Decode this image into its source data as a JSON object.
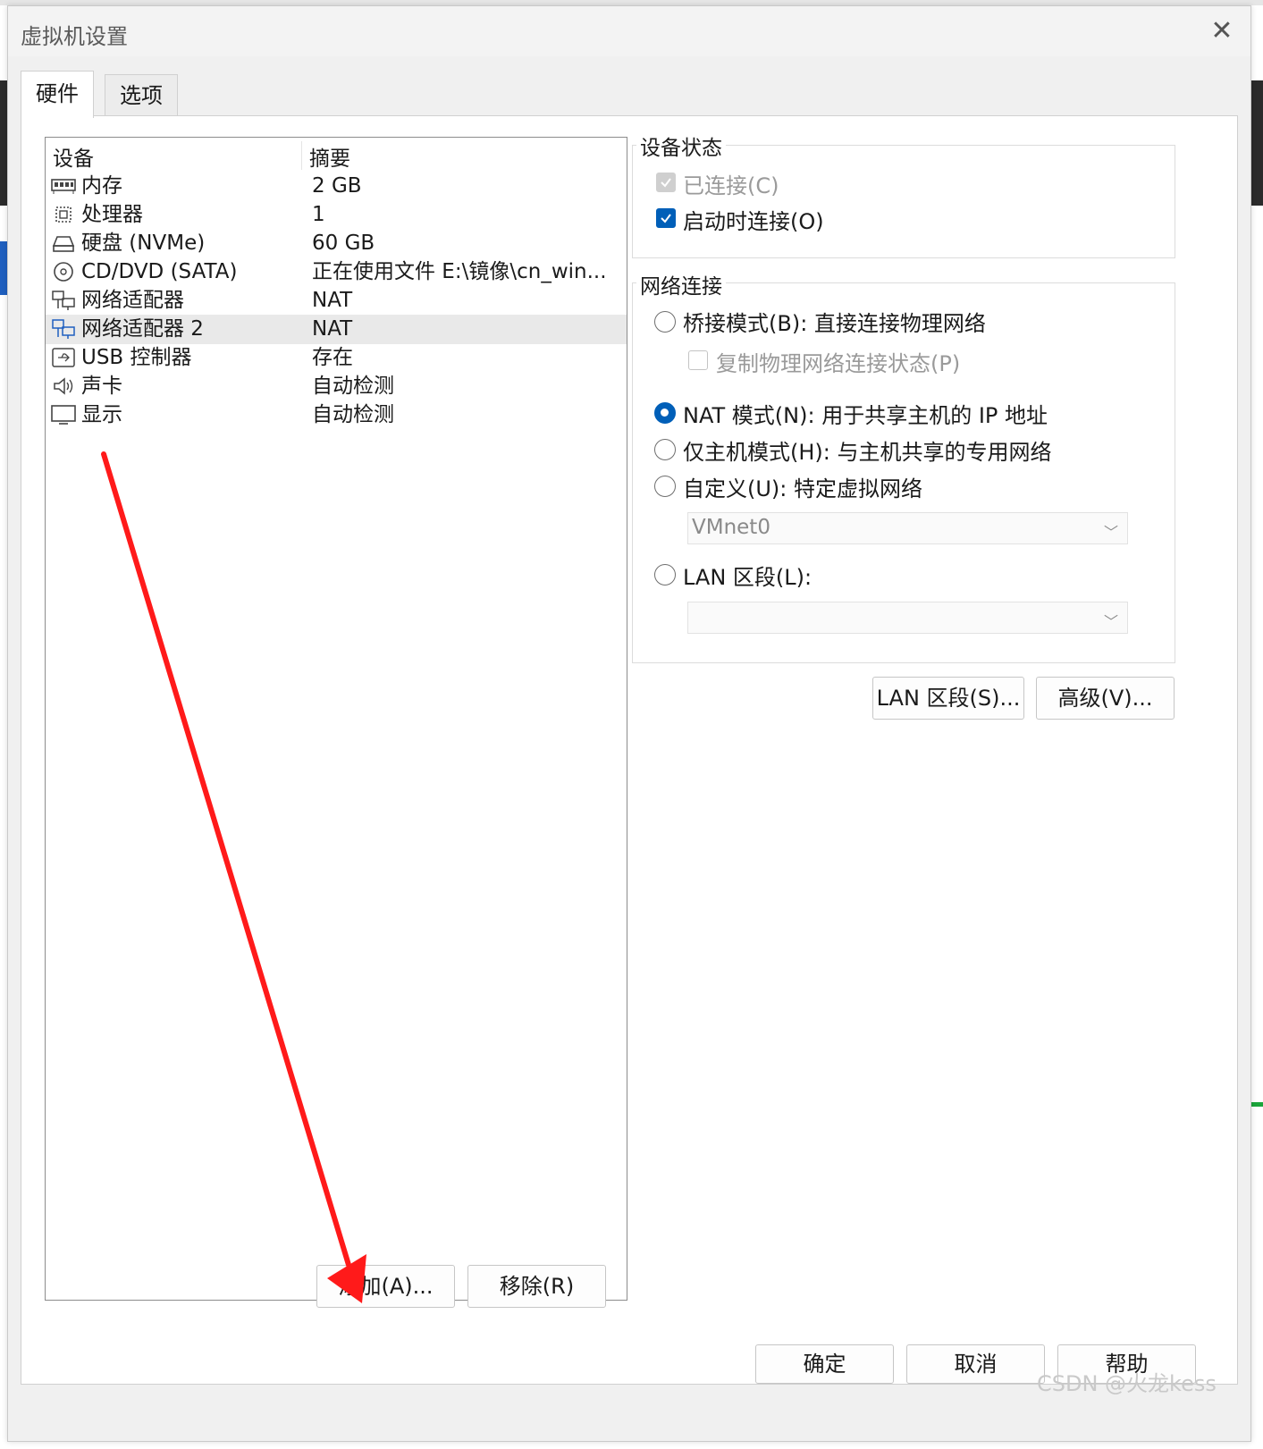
{
  "window": {
    "title": "虚拟机设置",
    "close_icon": "close-icon"
  },
  "tabs": [
    {
      "label": "硬件",
      "active": true
    },
    {
      "label": "选项",
      "active": false
    }
  ],
  "device_list": {
    "columns": [
      "设备",
      "摘要"
    ],
    "rows": [
      {
        "icon": "memory-icon",
        "name": "内存",
        "summary": "2 GB",
        "selected": false
      },
      {
        "icon": "processor-icon",
        "name": "处理器",
        "summary": "1",
        "selected": false
      },
      {
        "icon": "harddisk-icon",
        "name": "硬盘 (NVMe)",
        "summary": "60 GB",
        "selected": false
      },
      {
        "icon": "cdrom-icon",
        "name": "CD/DVD (SATA)",
        "summary": "正在使用文件 E:\\镜像\\cn_win...",
        "selected": false
      },
      {
        "icon": "network-adapter-icon",
        "name": "网络适配器",
        "summary": "NAT",
        "selected": false
      },
      {
        "icon": "network-adapter-icon",
        "name": "网络适配器 2",
        "summary": "NAT",
        "selected": true
      },
      {
        "icon": "usb-icon",
        "name": "USB 控制器",
        "summary": "存在",
        "selected": false
      },
      {
        "icon": "sound-icon",
        "name": "声卡",
        "summary": "自动检测",
        "selected": false
      },
      {
        "icon": "display-icon",
        "name": "显示",
        "summary": "自动检测",
        "selected": false
      }
    ]
  },
  "list_buttons": {
    "add": "添加(A)...",
    "remove": "移除(R)"
  },
  "device_status": {
    "label": "设备状态",
    "connected": {
      "label": "已连接(C)",
      "checked": true,
      "disabled": true
    },
    "connect_on_start": {
      "label": "启动时连接(O)",
      "checked": true,
      "disabled": false
    }
  },
  "network": {
    "label": "网络连接",
    "bridged": {
      "label": "桥接模式(B): 直接连接物理网络",
      "selected": false
    },
    "replicate": {
      "label": "复制物理网络连接状态(P)",
      "checked": false,
      "disabled": true
    },
    "nat": {
      "label": "NAT 模式(N): 用于共享主机的 IP 地址",
      "selected": true
    },
    "host_only": {
      "label": "仅主机模式(H): 与主机共享的专用网络",
      "selected": false
    },
    "custom": {
      "label": "自定义(U): 特定虚拟网络",
      "selected": false
    },
    "custom_select": {
      "value": "VMnet0"
    },
    "lan_segment": {
      "label": "LAN 区段(L):",
      "selected": false
    },
    "lan_select": {
      "value": ""
    }
  },
  "network_buttons": {
    "lan_segments": "LAN 区段(S)...",
    "advanced": "高级(V)..."
  },
  "footer_buttons": {
    "ok": "确定",
    "cancel": "取消",
    "help": "帮助"
  },
  "annotation": {
    "arrow_color": "#ff1a1a"
  },
  "watermark": "CSDN @火龙kess",
  "colors": {
    "accent": "#005fb8",
    "selected_row": "#e9e9e9"
  }
}
